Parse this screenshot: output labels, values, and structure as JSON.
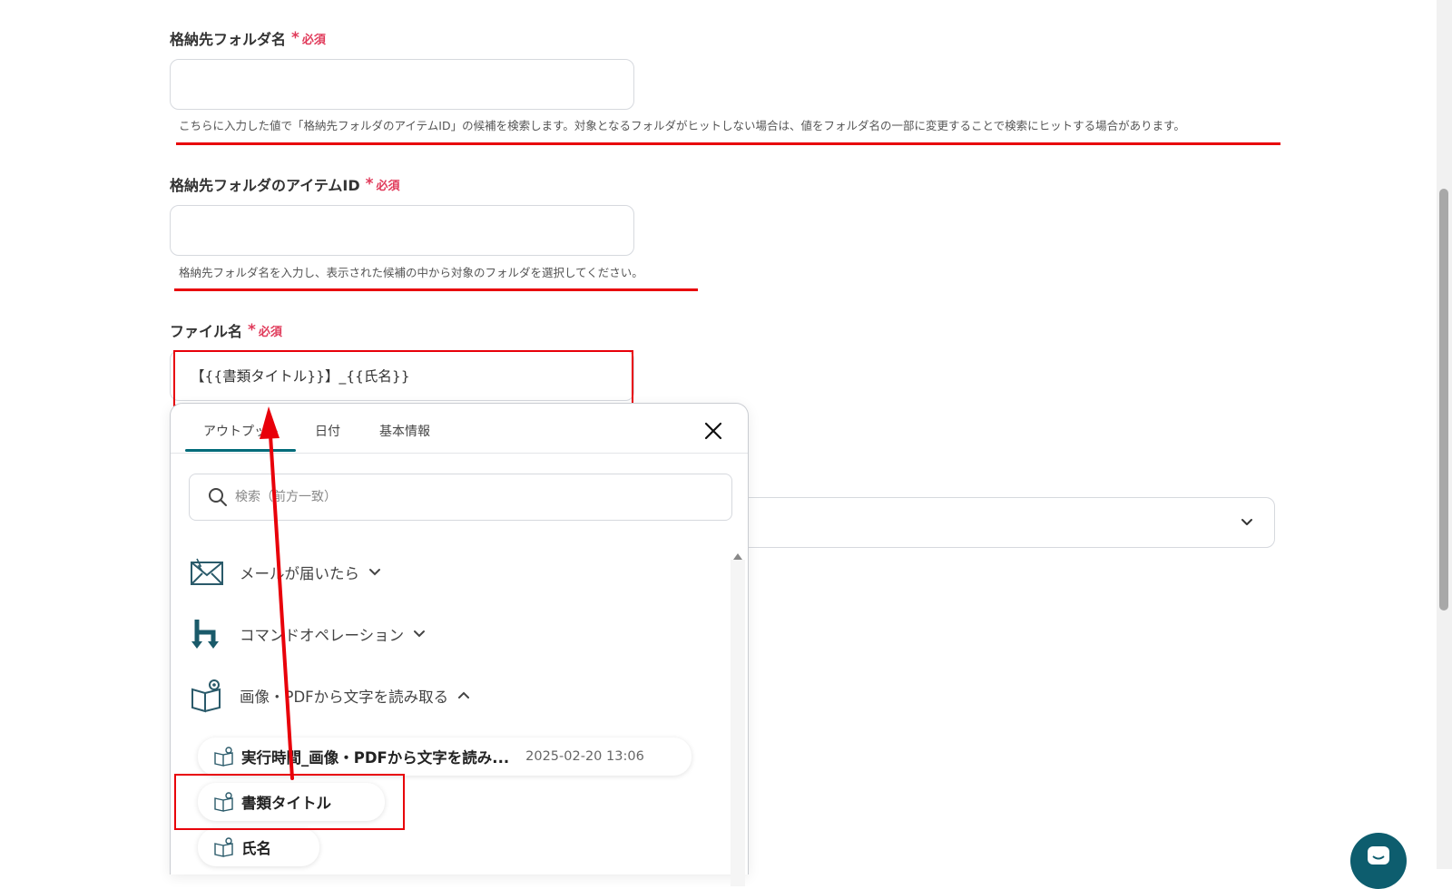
{
  "fields": {
    "folder_name": {
      "label": "格納先フォルダ名",
      "required": "必須",
      "value": "",
      "hint": "こちらに入力した値で「格納先フォルダのアイテムID」の候補を検索します。対象となるフォルダがヒットしない場合は、値をフォルダ名の一部に変更することで検索にヒットする場合があります。"
    },
    "folder_item_id": {
      "label": "格納先フォルダのアイテムID",
      "required": "必須",
      "value": "",
      "hint": "格納先フォルダ名を入力し、表示された候補の中から対象のフォルダを選択してください。"
    },
    "file_name": {
      "label": "ファイル名",
      "required": "必須",
      "value": "【{{書類タイトル}}】_{{氏名}}"
    }
  },
  "picker": {
    "tabs": [
      {
        "label": "アウトプット",
        "active": true
      },
      {
        "label": "日付",
        "active": false
      },
      {
        "label": "基本情報",
        "active": false
      }
    ],
    "search_placeholder": "検索（前方一致）",
    "groups": [
      {
        "label": "メールが届いたら",
        "icon": "mail-icon",
        "expanded": false
      },
      {
        "label": "コマンドオペレーション",
        "icon": "command-operation-icon",
        "expanded": false
      },
      {
        "label": "画像・PDFから文字を読み取る",
        "icon": "ocr-book-icon",
        "expanded": true
      }
    ],
    "items": [
      {
        "label": "実行時間_画像・PDFから文字を読み...",
        "date": "2025-02-20 13:06"
      },
      {
        "label": "書類タイトル",
        "date": ""
      },
      {
        "label": "氏名",
        "date": ""
      }
    ]
  },
  "colors": {
    "accent": "#006b7a",
    "required": "#e03a5a",
    "annotation": "#e8000a"
  }
}
